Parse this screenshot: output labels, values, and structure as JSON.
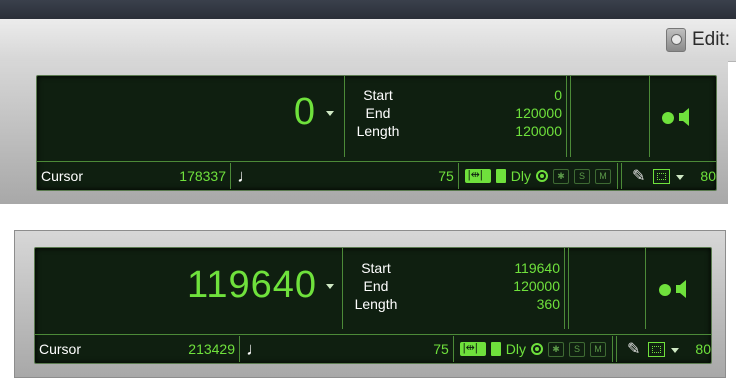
{
  "toolbar": {
    "edit_label": "Edit:"
  },
  "panels": [
    {
      "main_counter": "0",
      "selection": {
        "start_label": "Start",
        "end_label": "End",
        "length_label": "Length",
        "start": "0",
        "end": "120000",
        "length": "120000"
      },
      "cursor_label": "Cursor",
      "cursor_value": "178337",
      "tempo": "75",
      "dly_label": "Dly",
      "nudge": "80",
      "buttons": {
        "s": "S",
        "m": "M"
      }
    },
    {
      "main_counter": "119640",
      "selection": {
        "start_label": "Start",
        "end_label": "End",
        "length_label": "Length",
        "start": "119640",
        "end": "120000",
        "length": "360"
      },
      "cursor_label": "Cursor",
      "cursor_value": "213429",
      "tempo": "75",
      "dly_label": "Dly",
      "nudge": "80",
      "buttons": {
        "s": "S",
        "m": "M"
      }
    }
  ],
  "colors": {
    "lcd_bg": "#0f1f10",
    "lcd_green": "#6fe13c",
    "divider": "#4c8a38"
  }
}
